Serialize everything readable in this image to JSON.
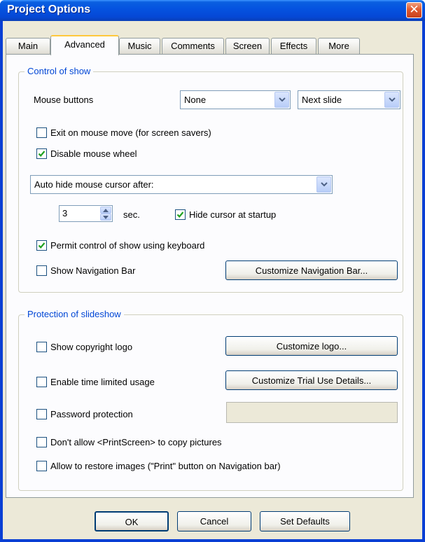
{
  "window": {
    "title": "Project Options"
  },
  "tabs": [
    "Main",
    "Advanced",
    "Music",
    "Comments",
    "Screen",
    "Effects",
    "More"
  ],
  "control": {
    "legend": "Control of show",
    "mouse_buttons_label": "Mouse buttons",
    "mouse_button_left": "None",
    "mouse_button_right": "Next slide",
    "exit_on_move": {
      "label": "Exit on mouse move (for screen savers)",
      "checked": false
    },
    "disable_wheel": {
      "label": "Disable mouse wheel",
      "checked": true
    },
    "auto_hide": "Auto hide mouse cursor after:",
    "seconds_value": "3",
    "seconds_unit": "sec.",
    "hide_at_startup": {
      "label": "Hide cursor at startup",
      "checked": true
    },
    "keyboard_control": {
      "label": "Permit control of show using keyboard",
      "checked": true
    },
    "show_nav_bar": {
      "label": "Show Navigation Bar",
      "checked": false
    },
    "customize_nav_button": "Customize Navigation Bar..."
  },
  "protection": {
    "legend": "Protection of slideshow",
    "copyright_logo": {
      "label": "Show copyright logo",
      "checked": false
    },
    "customize_logo_button": "Customize logo...",
    "time_limited": {
      "label": "Enable time limited usage",
      "checked": false
    },
    "customize_trial_button": "Customize Trial Use Details...",
    "password": {
      "label": "Password protection",
      "checked": false
    },
    "password_value": "",
    "printscreen": {
      "label": "Don't allow <PrintScreen> to copy pictures",
      "checked": false
    },
    "restore_images": {
      "label": "Allow to restore images (\"Print\" button on Navigation bar)",
      "checked": false
    }
  },
  "footer": {
    "ok": "OK",
    "cancel": "Cancel",
    "defaults": "Set Defaults"
  },
  "colors": {
    "title_bar": "#0553e0",
    "legend_text": "#0046d5",
    "active_tab_accent": "#ffc83c",
    "window_face": "#ece9d8",
    "close_button": "#e05a30"
  }
}
